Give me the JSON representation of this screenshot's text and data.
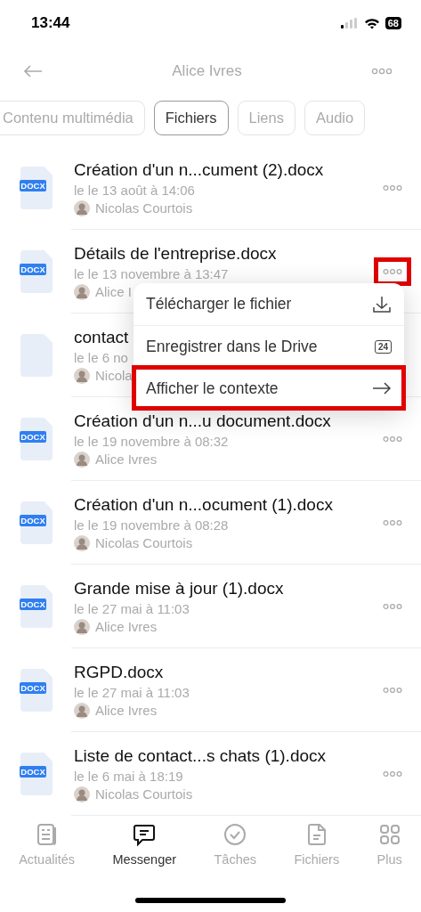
{
  "status_bar": {
    "time": "13:44",
    "battery": "68"
  },
  "header": {
    "title": "Alice Ivres"
  },
  "tabs": [
    {
      "label": "Contenu multimédia",
      "selected": false
    },
    {
      "label": "Fichiers",
      "selected": true
    },
    {
      "label": "Liens",
      "selected": false
    },
    {
      "label": "Audio",
      "selected": false
    }
  ],
  "files": [
    {
      "name": "Création d'un n...cument (2).docx",
      "date": "le le 13 août à 14:06",
      "author": "Nicolas Courtois",
      "badge": "DOCX",
      "highlighted": false
    },
    {
      "name": "Détails de l'entreprise.docx",
      "date": "le le 13 novembre à 13:47",
      "author": "Alice I",
      "badge": "DOCX",
      "highlighted": true
    },
    {
      "name": "contact",
      "date": "le le 6 no",
      "author": "Nicola"
    },
    {
      "name": "Création d'un n...u document.docx",
      "date": "le le 19 novembre à 08:32",
      "author": "Alice Ivres",
      "badge": "DOCX",
      "highlighted": false
    },
    {
      "name": "Création d'un n...ocument (1).docx",
      "date": "le le 19 novembre à 08:28",
      "author": "Nicolas Courtois",
      "badge": "DOCX",
      "highlighted": false
    },
    {
      "name": "Grande mise à jour (1).docx",
      "date": "le le 27 mai à 11:03",
      "author": "Alice Ivres",
      "badge": "DOCX",
      "highlighted": false
    },
    {
      "name": "RGPD.docx",
      "date": "le le 27 mai à 11:03",
      "author": "Alice Ivres",
      "badge": "DOCX",
      "highlighted": false
    },
    {
      "name": "Liste de contact...s chats (1).docx",
      "date": "le le 6 mai à 18:19",
      "author": "Nicolas Courtois",
      "badge": "DOCX",
      "highlighted": false
    }
  ],
  "context_menu": [
    {
      "label": "Télécharger le fichier",
      "kind": "download",
      "highlighted": false
    },
    {
      "label": "Enregistrer dans le Drive",
      "kind": "drive",
      "badge": "24",
      "highlighted": false
    },
    {
      "label": "Afficher le contexte",
      "kind": "arrow",
      "highlighted": true
    }
  ],
  "bottom_nav": [
    {
      "label": "Actualités",
      "kind": "news",
      "selected": false
    },
    {
      "label": "Messenger",
      "kind": "chat",
      "selected": true
    },
    {
      "label": "Tâches",
      "kind": "tasks",
      "selected": false
    },
    {
      "label": "Fichiers",
      "kind": "files",
      "selected": false
    },
    {
      "label": "Plus",
      "kind": "more",
      "selected": false
    }
  ]
}
